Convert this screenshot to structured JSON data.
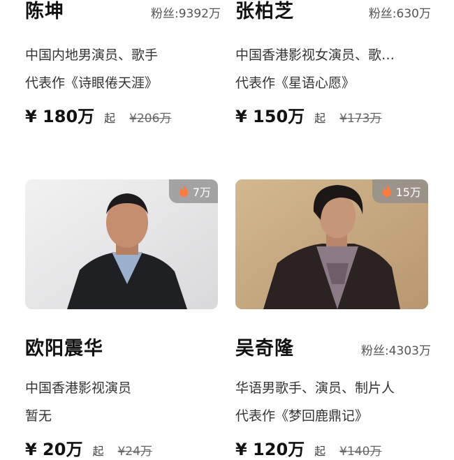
{
  "cards": [
    {
      "name": "陈坤",
      "fans": "粉丝:9392万",
      "line1": "中国内地男演员、歌手",
      "line2": "代表作《诗眼倦天涯》",
      "price": "¥ 180万",
      "qi": "起",
      "orig": "¥206万"
    },
    {
      "name": "张柏芝",
      "fans": "粉丝:630万",
      "line1": "中国香港影视女演员、歌…",
      "line2": "代表作《星语心愿》",
      "price": "¥ 150万",
      "qi": "起",
      "orig": "¥173万"
    },
    {
      "name": "欧阳震华",
      "fans": "",
      "heat": "7万",
      "line1": "中国香港影视演员",
      "line2": "暂无",
      "price": "¥ 20万",
      "qi": "起",
      "orig": "¥24万"
    },
    {
      "name": "吴奇隆",
      "fans": "粉丝:4303万",
      "heat": "15万",
      "line1": "华语男歌手、演员、制片人",
      "line2": "代表作《梦回鹿鼎记》",
      "price": "¥ 120万",
      "qi": "起",
      "orig": "¥140万"
    }
  ],
  "colors": {
    "photo1_bg": "#e9e9ea",
    "photo2_bg": "#c6a980"
  }
}
